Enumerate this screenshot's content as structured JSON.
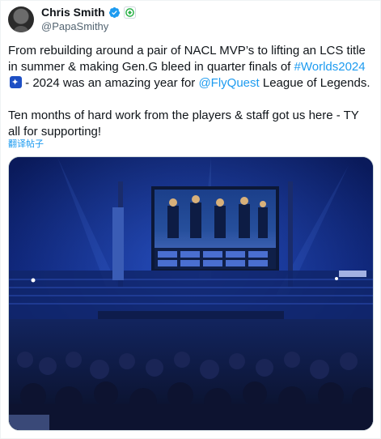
{
  "author": {
    "display_name": "Chris Smith",
    "handle": "@PapaSmithy",
    "avatar_icon": "avatar-photo",
    "verified_icon": "verified-badge-icon",
    "affiliation_icon": "affiliate-badge-icon"
  },
  "tweet": {
    "line1_pre": "From rebuilding around a pair of NACL MVP’s to lifting an LCS title in summer & making Gen.G bleed in quarter finals of ",
    "hashtag": "#Worlds2024",
    "line1_post": " - 2024 was an amazing year for ",
    "mention": "@FlyQuest",
    "line1_end": " League of Legends.",
    "paragraph2": "Ten months of hard work from the players & staff got us here - TY all for supporting!",
    "translate_label": "翻译帖子"
  },
  "media": {
    "type": "photo",
    "subject": "arena-stage-photo"
  },
  "colors": {
    "link": "#1d9bf0",
    "text": "#0f1419",
    "secondary": "#536471",
    "verified": "#1d9bf0"
  }
}
